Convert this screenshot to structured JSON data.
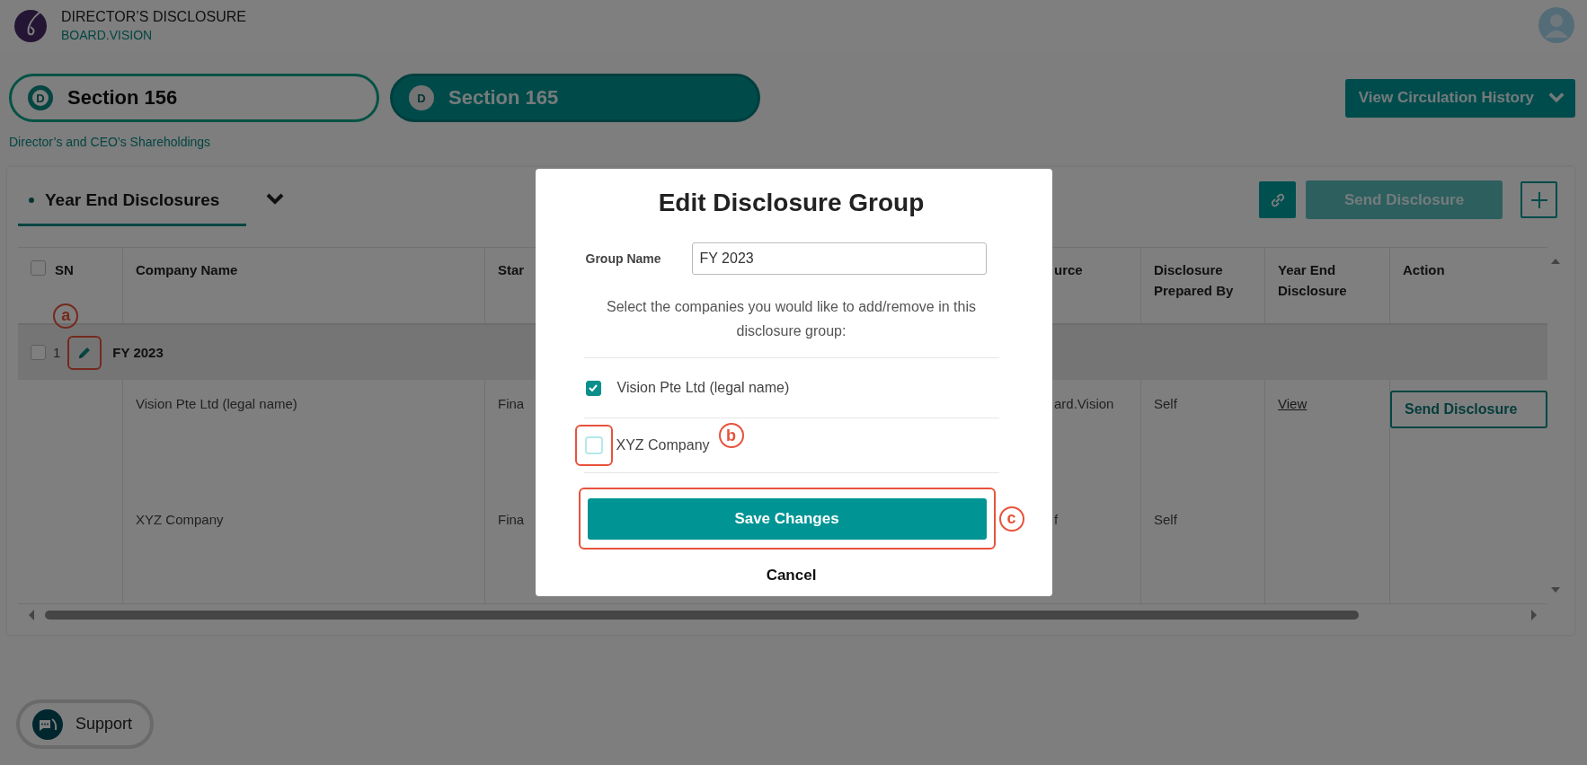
{
  "app": {
    "title": "DIRECTOR’S DISCLOSURE",
    "subtitle": "BOARD.VISION"
  },
  "sections": [
    {
      "badge": "D",
      "label": "Section 156",
      "selected": true
    },
    {
      "badge": "D",
      "label": "Section 165",
      "selected": false
    }
  ],
  "section_caption": "Director’s and CEO’s Shareholdings",
  "circulation_button": "View Circulation History",
  "disclosure_tab": {
    "label": "Year End Disclosures",
    "selected": true
  },
  "toolbar": {
    "send_button": {
      "label": "Send Disclosure",
      "disabled": true
    }
  },
  "table": {
    "select_all": {
      "checked": false
    },
    "columns": [
      "SN",
      "Company Name",
      "Star",
      "urce",
      "Disclosure Prepared By",
      "Year End Disclosure",
      "Action"
    ],
    "groups": [
      {
        "sn": "1",
        "name": "FY 2023",
        "checked": false,
        "callout": "a",
        "rows": [
          {
            "company": "Vision Pte Ltd (legal name)",
            "column_3": "Fina",
            "column_4": "ard.Vision",
            "prepared_by": "Self",
            "year_end_link": "View",
            "action_button": "Send Disclosure"
          },
          {
            "company": "XYZ Company",
            "column_3": "Fina",
            "column_4": "f",
            "prepared_by": "Self"
          }
        ]
      }
    ]
  },
  "modal": {
    "title": "Edit Disclosure Group",
    "group_name_label": "Group Name",
    "group_name_value": "FY 2023",
    "instructions": "Select the companies you would like to add/remove in this disclosure group:",
    "companies": [
      {
        "name": "Vision Pte Ltd (legal name)",
        "checked": true
      },
      {
        "name": "XYZ Company",
        "checked": false,
        "callout": "b"
      }
    ],
    "save_button": {
      "label": "Save Changes",
      "callout": "c"
    },
    "cancel_button": "Cancel"
  },
  "support_button": "Support"
}
